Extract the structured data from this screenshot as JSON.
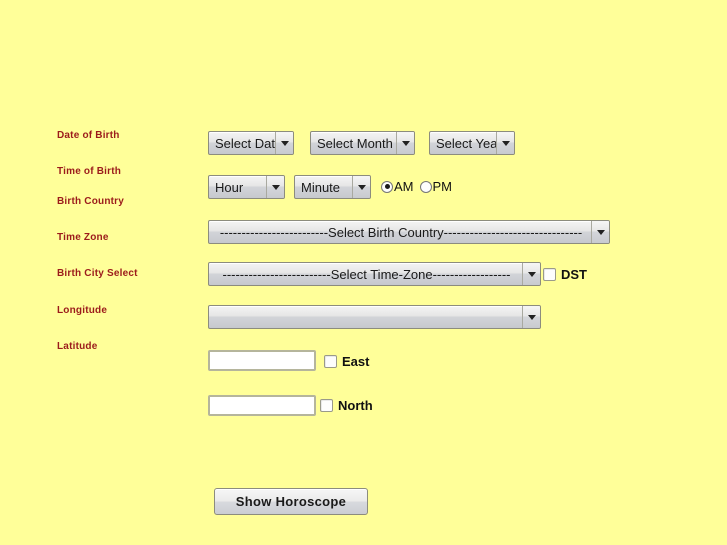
{
  "theme": {
    "background_color": "#ffff99",
    "label_color": "#9b1b1b",
    "control_face_color": "#d7d9dd",
    "control_border_color": "#8c8c7e",
    "input_background_color": "#ffffff",
    "text_color": "#1a1a1a"
  },
  "labels": {
    "date_of_birth": "Date of Birth",
    "time_of_birth": "Time of Birth",
    "birth_country": "Birth Country",
    "time_zone": "Time Zone",
    "birth_city_select": "Birth City Select",
    "longitude": "Longitude",
    "latitude": "Latitude"
  },
  "date_of_birth": {
    "day": {
      "value": "Select Dat",
      "full_text": "Select Date"
    },
    "month": {
      "value": "Select Month"
    },
    "year": {
      "value": "Select Yea",
      "full_text": "Select Year"
    }
  },
  "time_of_birth": {
    "hour": {
      "value": "Hour"
    },
    "minute": {
      "value": "Minute"
    },
    "meridiem": {
      "options": [
        {
          "label": "AM",
          "selected": true
        },
        {
          "label": "PM",
          "selected": false
        }
      ]
    }
  },
  "birth_country": {
    "value": "-------------------------Select Birth Country--------------------------------"
  },
  "time_zone": {
    "value": "-------------------------Select Time-Zone------------------",
    "dst": {
      "label": "DST",
      "checked": false
    }
  },
  "birth_city": {
    "value": ""
  },
  "longitude": {
    "value": "",
    "placeholder": "",
    "direction": {
      "label": "East",
      "checked": false
    }
  },
  "latitude": {
    "value": "",
    "placeholder": "",
    "direction": {
      "label": "North",
      "checked": false
    }
  },
  "submit": {
    "label": "Show Horoscope"
  }
}
